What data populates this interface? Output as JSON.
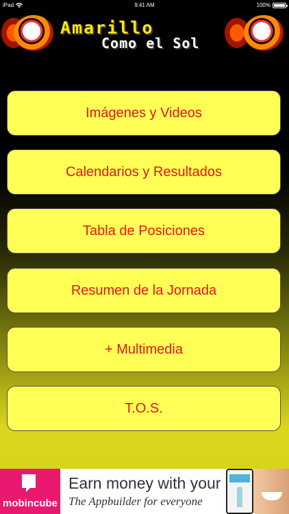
{
  "status_bar": {
    "device": "iPad",
    "wifi_icon": "wifi-icon",
    "time": "9:41 AM",
    "battery_percent": "100%",
    "battery_level": 1.0
  },
  "banner": {
    "title": "Amarillo",
    "subtitle": "Como el Sol",
    "logo_icon": "flaming-soccer-ball-icon"
  },
  "menu": [
    {
      "label": "Imágenes y Videos"
    },
    {
      "label": "Calendarios y Resultados"
    },
    {
      "label": "Tabla de Posiciones"
    },
    {
      "label": "Resumen de la Jornada"
    },
    {
      "label": "+ Multimedia"
    },
    {
      "label": "T.O.S."
    }
  ],
  "ad": {
    "brand": "mobincube",
    "headline": "Earn money with your apps",
    "subline": "The Appbuilder for everyone"
  },
  "colors": {
    "button_fill": "#ffff55",
    "button_text": "#e0181d",
    "title_yellow": "#f3e816",
    "ad_brand": "#e8196f"
  }
}
